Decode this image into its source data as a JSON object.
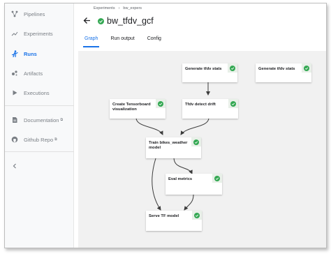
{
  "sidebar": {
    "items": [
      {
        "label": "Pipelines",
        "icon": "pipelines-icon"
      },
      {
        "label": "Experiments",
        "icon": "experiments-icon"
      },
      {
        "label": "Runs",
        "icon": "runs-icon",
        "active": true
      },
      {
        "label": "Artifacts",
        "icon": "artifacts-icon"
      },
      {
        "label": "Executions",
        "icon": "executions-icon"
      }
    ],
    "links": [
      {
        "label": "Documentation",
        "icon": "documentation-icon"
      },
      {
        "label": "Github Repo",
        "icon": "github-icon"
      }
    ],
    "collapse_icon": "chevron-left-icon"
  },
  "breadcrumb": {
    "items": [
      "Experiments",
      "bw_expers"
    ],
    "separator": "›"
  },
  "run": {
    "title": "bw_tfdv_gcf",
    "status": "succeeded"
  },
  "tabs": [
    {
      "label": "Graph",
      "active": true
    },
    {
      "label": "Run output"
    },
    {
      "label": "Config"
    }
  ],
  "graph": {
    "nodes": [
      {
        "id": "gen1",
        "label": "Generate tfdv stats",
        "status": "succeeded"
      },
      {
        "id": "gen2",
        "label": "Generate tfdv stats",
        "status": "succeeded"
      },
      {
        "id": "tb",
        "label": "Create Tensorboard visualization",
        "status": "succeeded"
      },
      {
        "id": "drift",
        "label": "Tfdv detect drift",
        "status": "succeeded"
      },
      {
        "id": "train",
        "label": "Train bikes_weather model",
        "status": "succeeded"
      },
      {
        "id": "eval",
        "label": "Eval metrics",
        "status": "succeeded"
      },
      {
        "id": "serve",
        "label": "Serve TF model",
        "status": "succeeded"
      }
    ]
  },
  "colors": {
    "accent": "#1a73e8",
    "success": "#34a853",
    "canvas": "#f1f1f1"
  }
}
